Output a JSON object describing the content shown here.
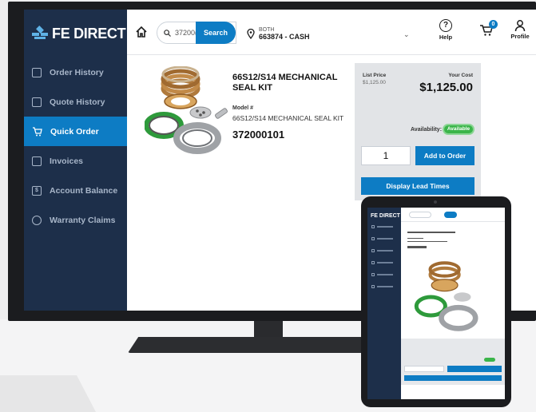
{
  "brand": {
    "name": "FE DIRECT",
    "accent": "#0d7cc4",
    "sidebar_bg": "#1d2f4a",
    "success": "#3bb54a"
  },
  "sidebar": {
    "items": [
      {
        "label": "Order History",
        "icon": "clipboard-icon"
      },
      {
        "label": "Quote History",
        "icon": "document-icon"
      },
      {
        "label": "Quick Order",
        "icon": "cart-icon",
        "active": true
      },
      {
        "label": "Invoices",
        "icon": "file-icon"
      },
      {
        "label": "Account Balance",
        "icon": "dollar-icon"
      },
      {
        "label": "Warranty Claims",
        "icon": "circle-icon"
      }
    ]
  },
  "topbar": {
    "search_value": "37200(",
    "search_button": "Search",
    "account_label": "BOTH",
    "account_number": "663874 - CASH",
    "help_label": "Help",
    "cart_count": "0",
    "profile_label": "Profile"
  },
  "product": {
    "title": "66S12/S14 MECHANICAL SEAL KIT",
    "model_label": "Model #",
    "model_value": "66S12/S14 MECHANICAL SEAL KIT",
    "part_number": "372000101"
  },
  "pricing": {
    "list_price_label": "List Price",
    "list_price_value": "$1,125.00",
    "your_cost_label": "Your Cost",
    "your_cost_value": "$1,125.00",
    "availability_label": "Availability:",
    "availability_status": "Available",
    "quantity": "1",
    "add_to_order": "Add to Order",
    "display_lead_times": "Display Lead Times"
  },
  "tablet": {
    "logo": "FE DIRECT"
  }
}
